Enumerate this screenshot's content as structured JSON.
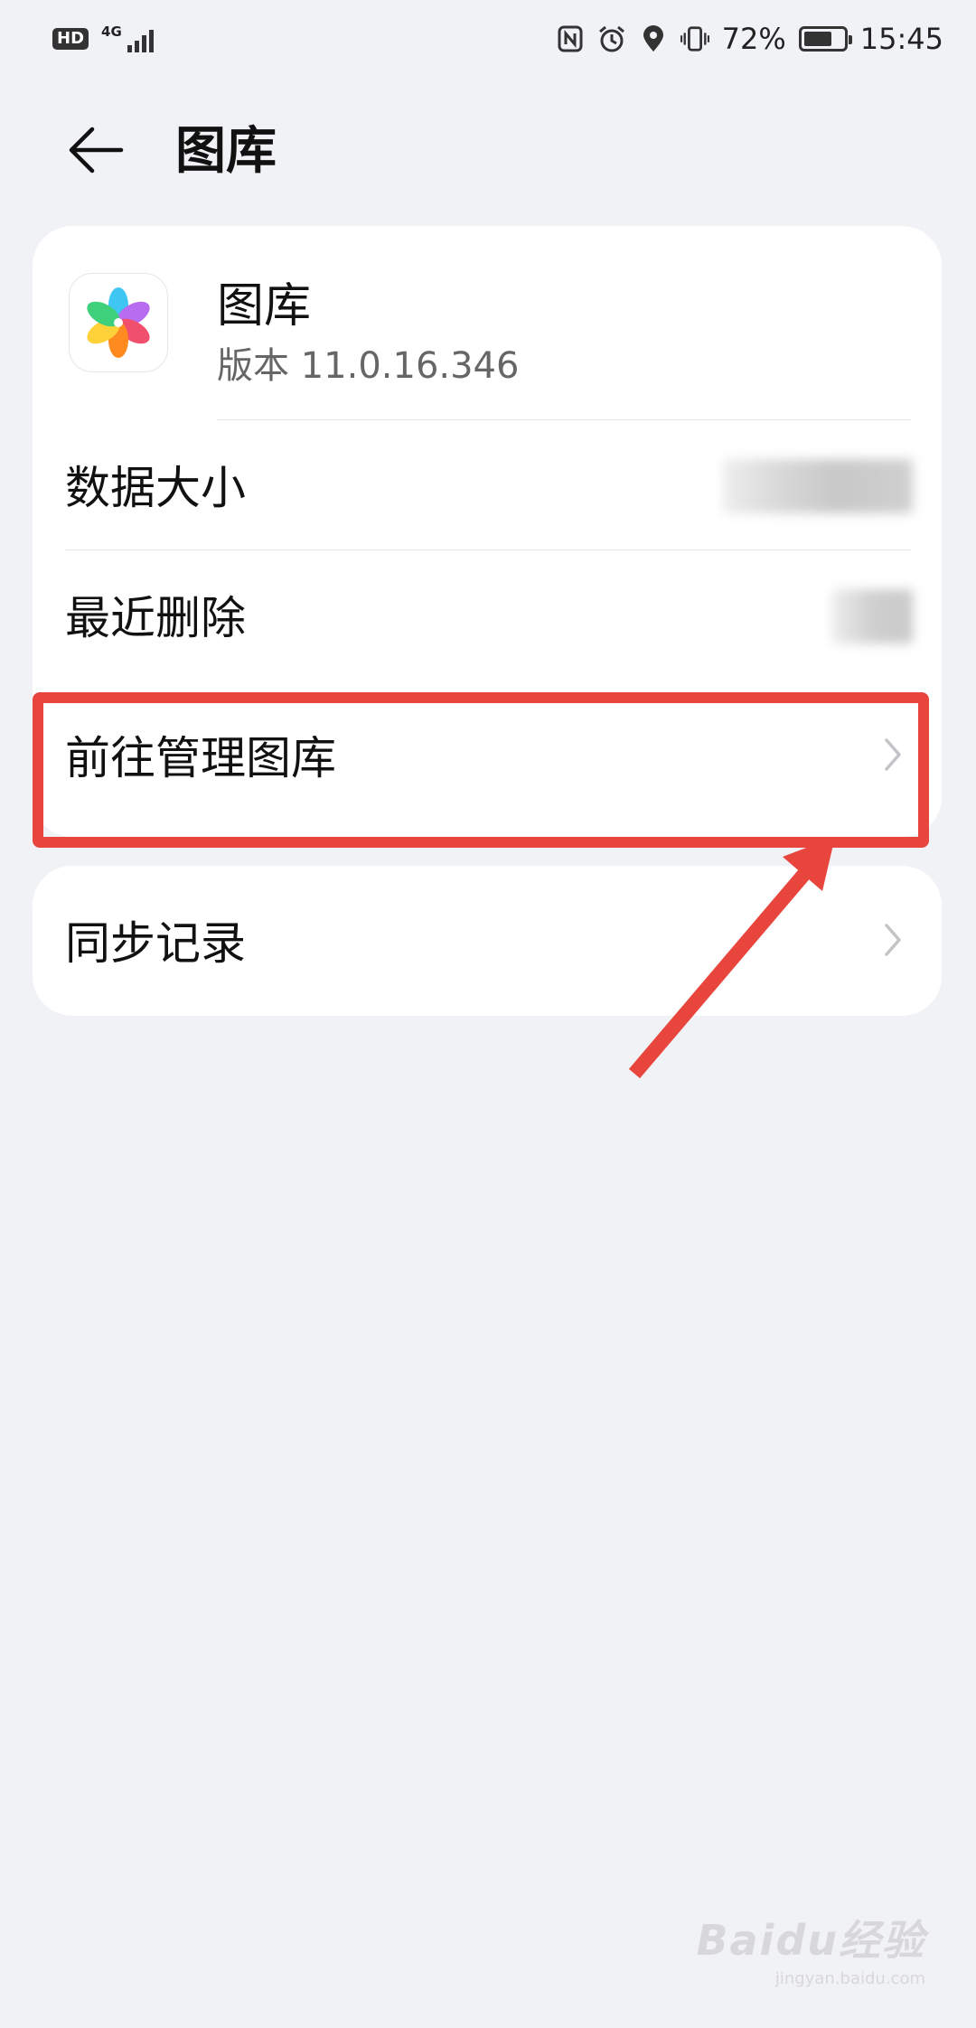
{
  "status_bar": {
    "hd_badge": "HD",
    "network_type": "4G",
    "battery_percent": "72%",
    "battery_level": 0.72,
    "time": "15:45",
    "icons": [
      "nfc-icon",
      "alarm-icon",
      "location-icon",
      "vibrate-icon",
      "battery-icon"
    ]
  },
  "header": {
    "back_icon": "back-arrow-icon",
    "title": "图库"
  },
  "app_info": {
    "name": "图库",
    "version": "版本 11.0.16.346",
    "icon": "gallery-flower-icon"
  },
  "storage": {
    "data_size_label": "数据大小",
    "recently_deleted_label": "最近删除",
    "manage_gallery_label": "前往管理图库"
  },
  "sync": {
    "sync_record_label": "同步记录"
  },
  "annotation": {
    "highlight_color": "#e8453c"
  },
  "watermark": {
    "main": "Baidu经验",
    "sub": "jingyan.baidu.com"
  }
}
